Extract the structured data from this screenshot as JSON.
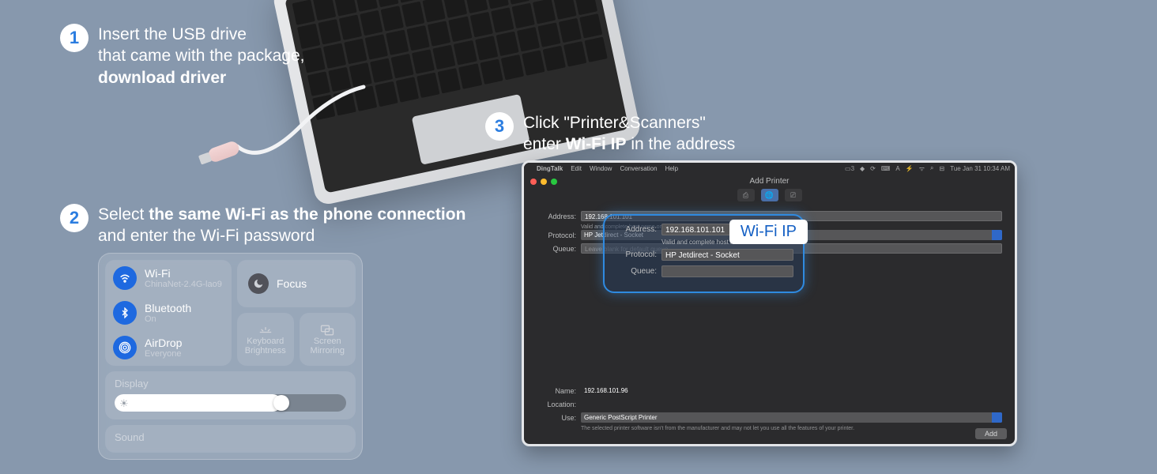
{
  "steps": {
    "1": {
      "num": "1",
      "line1": "Insert the USB drive",
      "line2": "that came with the package,",
      "line3": "download driver"
    },
    "2": {
      "num": "2",
      "line1a": "Select ",
      "line1b": "the same Wi-Fi as the phone connection",
      "line2": "and enter the Wi-Fi password"
    },
    "3": {
      "num": "3",
      "line1": "Click \"Printer&Scanners\"",
      "line2a": "enter ",
      "line2b": "Wi-Fi IP",
      "line2c": " in the address"
    }
  },
  "controlCenter": {
    "wifi": {
      "title": "Wi-Fi",
      "meta": "ChinaNet-2.4G-lao9"
    },
    "bluetooth": {
      "title": "Bluetooth",
      "meta": "On"
    },
    "airdrop": {
      "title": "AirDrop",
      "meta": "Everyone"
    },
    "focus": "Focus",
    "keyboardBrightness": "Keyboard Brightness",
    "screenMirroring": "Screen Mirroring",
    "display": "Display",
    "sound": "Sound"
  },
  "macMenubar": {
    "app": "DingTalk",
    "items": [
      "Edit",
      "Window",
      "Conversation",
      "Help"
    ],
    "date": "Tue Jan 31  10:34 AM",
    "badge": "3"
  },
  "addPrinter": {
    "title": "Add Printer",
    "addressLabel": "Address:",
    "address": "192.168.101.101",
    "addressNote": "Valid and complete host name or address.",
    "protocolLabel": "Protocol:",
    "protocol": "HP Jetdirect - Socket",
    "queueLabel": "Queue:",
    "queuePlaceholder": "Leave blank for default queue.",
    "nameLabel": "Name:",
    "name": "192.168.101.96",
    "locationLabel": "Location:",
    "useLabel": "Use:",
    "use": "Generic PostScript Printer",
    "useNote": "The selected printer software isn't from the manufacturer and may not let you use all the features of your printer.",
    "addBtn": "Add"
  },
  "callout": {
    "addressLabel": "Address:",
    "address": "192.168.101.101",
    "note": "Valid and complete host name or address.",
    "protocolLabel": "Protocol:",
    "protocol": "HP Jetdirect - Socket",
    "queueLabel": "Queue:",
    "bubble": "Wi-Fi IP"
  }
}
